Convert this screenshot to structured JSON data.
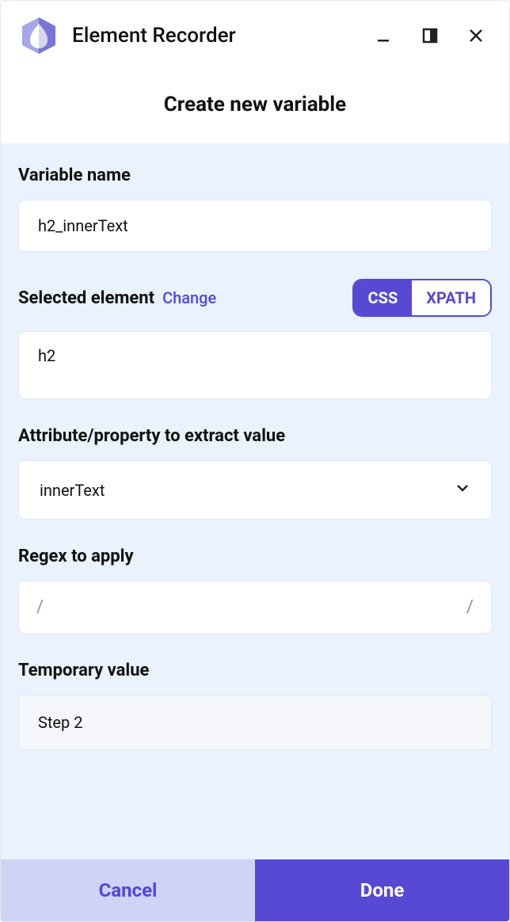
{
  "header": {
    "app_title": "Element Recorder",
    "page_title": "Create new variable"
  },
  "form": {
    "variable_name": {
      "label": "Variable name",
      "value": "h2_innerText"
    },
    "selected_element": {
      "label": "Selected element",
      "change_label": "Change",
      "selector_value": "h2",
      "toggle": {
        "css_label": "CSS",
        "xpath_label": "XPATH",
        "active": "css"
      }
    },
    "attribute": {
      "label": "Attribute/property to extract value",
      "value": "innerText"
    },
    "regex": {
      "label": "Regex to apply",
      "prefix": "/",
      "suffix": "/"
    },
    "temporary_value": {
      "label": "Temporary value",
      "value": "Step 2"
    }
  },
  "footer": {
    "cancel_label": "Cancel",
    "done_label": "Done"
  }
}
